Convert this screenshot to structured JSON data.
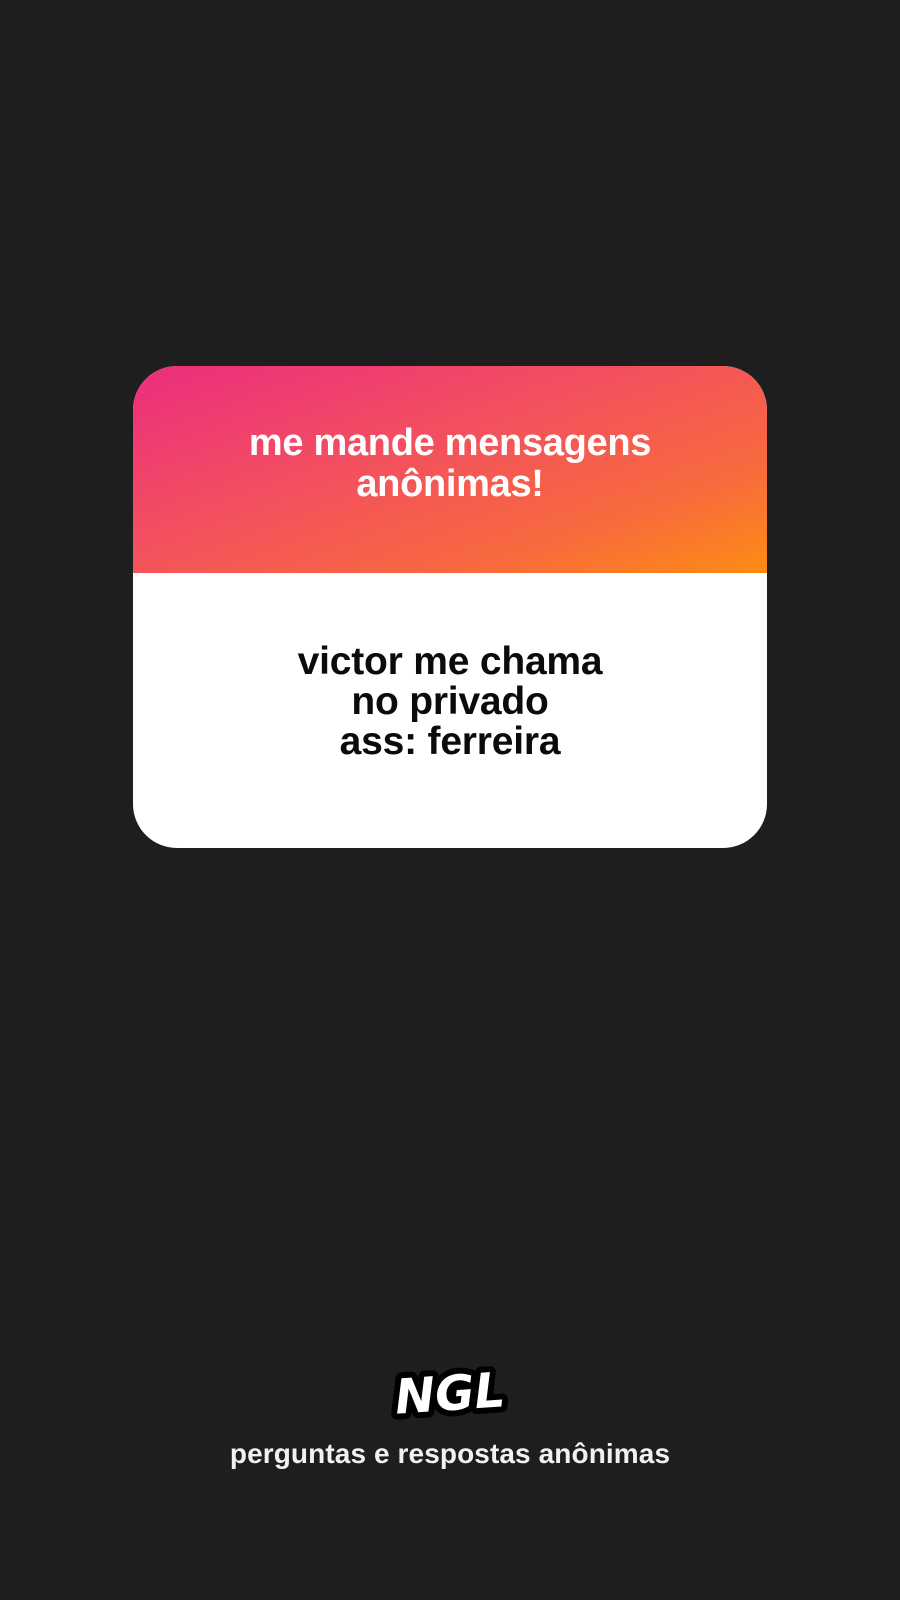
{
  "card": {
    "header_title": "me mande mensagens anônimas!",
    "message": "victor me chama\nno privado\nass: ferreira"
  },
  "footer": {
    "logo_text": "NGL",
    "tagline": "perguntas e respostas anônimas"
  },
  "colors": {
    "background": "#1e1e1e",
    "gradient_start": "#ec2d7e",
    "gradient_end": "#fe8c14",
    "card_body": "#ffffff"
  }
}
